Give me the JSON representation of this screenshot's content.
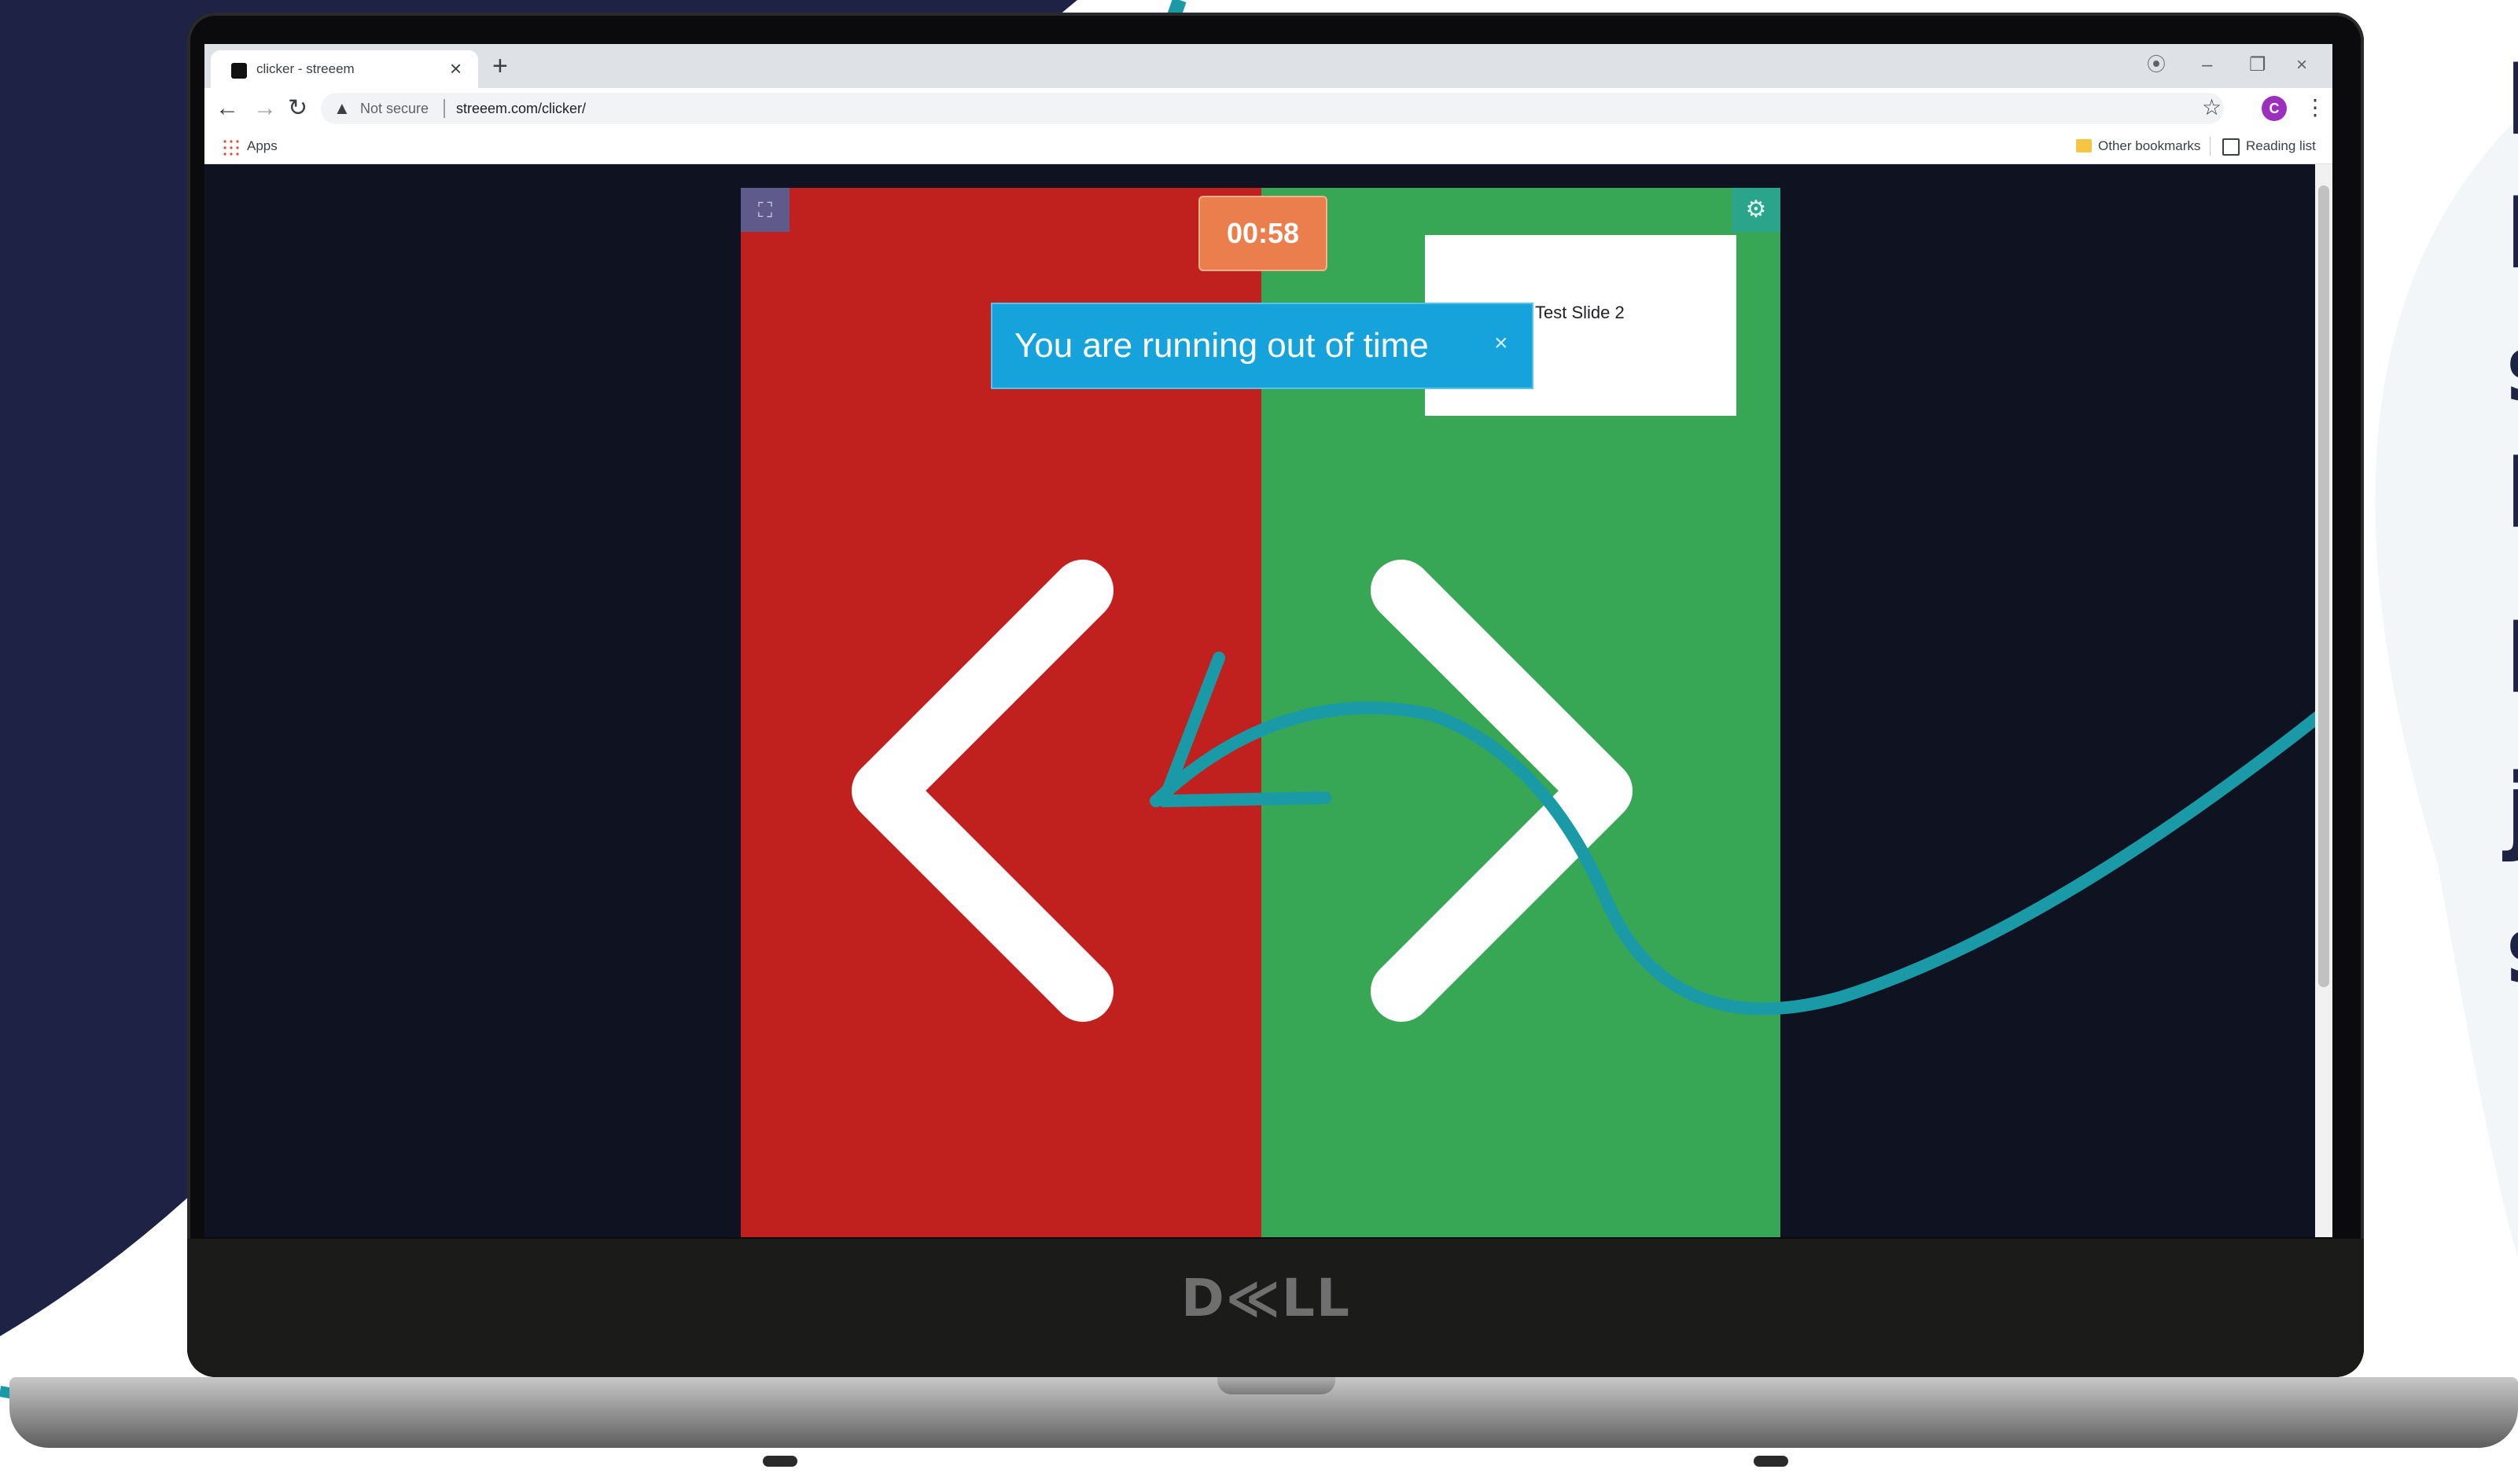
{
  "colors": {
    "navy": "#1e2345",
    "teal_accent": "#1a9aa6",
    "prev_panel": "#c0201e",
    "next_panel": "#37a755",
    "timer_bg": "#ea7f4d",
    "alert_bg": "#16a3dc",
    "page_bg": "#0f1220"
  },
  "laptop": {
    "brand": "D≪LL"
  },
  "browser": {
    "tab_title": "clicker - streeem",
    "new_tab_label": "+",
    "tab_close_icon": "×",
    "window_controls": [
      "–",
      "❐",
      "×"
    ],
    "address": {
      "security_label": "Not secure",
      "url": "streeem.com/clicker/"
    },
    "profile_initial": "C",
    "bookmarks": {
      "apps": "Apps",
      "other": "Other bookmarks",
      "reading_list": "Reading list"
    }
  },
  "clicker": {
    "timer": "00:58",
    "alert_message": "You are running out of time",
    "alert_close": "×",
    "slide_preview_title": "Test Slide 2",
    "fullscreen_icon": "fullscreen-icon",
    "settings_icon": "gear-icon",
    "prev_icon": "chevron-left-icon",
    "next_icon": "chevron-right-icon"
  }
}
